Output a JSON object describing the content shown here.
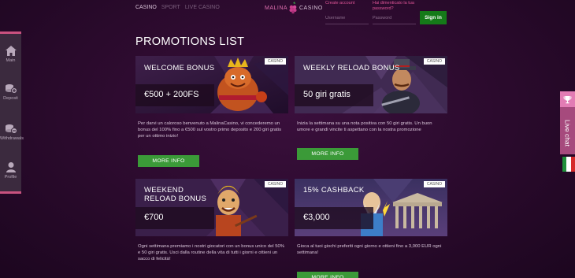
{
  "topnav": {
    "casino": "CASINO",
    "sport": "SPORT",
    "live_casino": "LIVE CASINO"
  },
  "logo": {
    "word1": "MALINA",
    "word2": "CASINO"
  },
  "login": {
    "create_account": "Create account",
    "forgot_password": "Hai dimenticato la tua password?",
    "username_placeholder": "Username",
    "password_placeholder": "Password",
    "signin_label": "Sign in"
  },
  "page_title": "PROMOTIONS LIST",
  "sidebar": {
    "items": [
      {
        "label": "Main",
        "icon": "home-icon"
      },
      {
        "label": "Deposit",
        "icon": "deposit-icon"
      },
      {
        "label": "Withdrawals",
        "icon": "withdrawals-icon"
      },
      {
        "label": "Profile",
        "icon": "profile-icon"
      }
    ]
  },
  "live_chat": {
    "label": "Live chat",
    "icon": "trophy-icon"
  },
  "language_flag": {
    "icon": "italy-flag-icon",
    "colors": [
      "#1f8f3a",
      "#ffffff",
      "#d62b2b"
    ]
  },
  "promotions": [
    {
      "badge": "CASINO",
      "title": "WELCOME BONUS",
      "amount": "€500 + 200FS",
      "description": "Per darvi un caloroso benvenuto a MalinaCasino, vi concederemo un bonus del 100% fino a €500 sul vostro primo deposito e 200 giri gratis per un ottimo inizio!",
      "button": "MORE INFO"
    },
    {
      "badge": "CASINO",
      "title": "WEEKLY RELOAD BONUS",
      "amount": "50 giri gratis",
      "description": "Inizia la settimana su una nota positiva con 50 giri gratis. Un buon umore e grandi vincite ti aspettano con la nostra promozione",
      "button": "MORE INFO"
    },
    {
      "badge": "CASINO",
      "title": "WEEKEND RELOAD BONUS",
      "amount": "€700",
      "description": "Ogni settimana premiamo i nostri giocatori con un bonus unico del 50% e 50 giri gratis. Usci dalla routine della vita di tutti i giorni e ottieni un sacco di felicità!",
      "button": "MORE INFO"
    },
    {
      "badge": "CASINO",
      "title": "15% CASHBACK",
      "amount": "€3,000",
      "description": "Gioca al tuoi giochi preferiti ogni giorno e ottieni fino a 3,000 EUR ogni settimana!",
      "button": "MORE INFO"
    }
  ],
  "colors": {
    "accent_pink": "#e05598",
    "signin_green": "#157a19",
    "more_info_green": "#3b9a38",
    "background": "#2a0a2c"
  }
}
